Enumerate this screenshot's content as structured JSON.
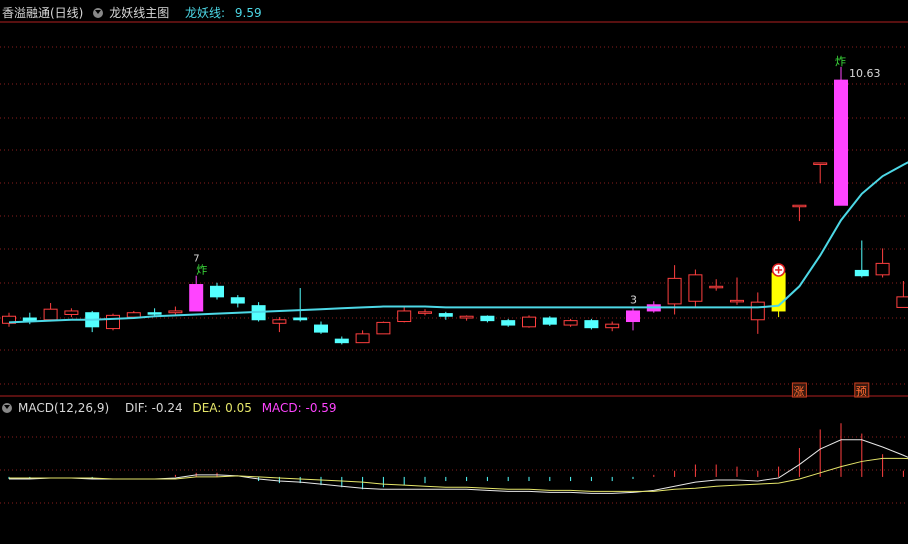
{
  "header_main": {
    "stock": "香溢融通(日线)",
    "indicator": "龙妖线主图",
    "line_label": "龙妖线:",
    "line_value": "9.59"
  },
  "header_macd": {
    "name": "MACD(12,26,9)",
    "dif": "DIF: -0.24",
    "dea": "DEA: 0.05",
    "macd": "MACD: -0.59"
  },
  "colors": {
    "up": "#ff4040",
    "down": "#54ffff",
    "signal_bar": "#ff44ff",
    "limit_up_bar": "#ffff00",
    "line": "#4dd8e6",
    "grid": "#8a1e1e"
  },
  "annotations": {
    "zha_1": "炸",
    "num_7": "7",
    "num_3": "3",
    "zha_2": "炸",
    "high_label": "10.63",
    "zhang": "涨",
    "yu": "预"
  },
  "chart_data": [
    {
      "type": "candlestick",
      "price_range": [
        7.0,
        11.2
      ],
      "high_mark": 10.63,
      "candles": [
        {
          "o": 7.78,
          "c": 7.86,
          "h": 7.9,
          "l": 7.74,
          "k": "up"
        },
        {
          "o": 7.84,
          "c": 7.8,
          "h": 7.9,
          "l": 7.77,
          "k": "down"
        },
        {
          "o": 7.82,
          "c": 7.94,
          "h": 8.01,
          "l": 7.8,
          "k": "up"
        },
        {
          "o": 7.88,
          "c": 7.92,
          "h": 7.95,
          "l": 7.85,
          "k": "up"
        },
        {
          "o": 7.9,
          "c": 7.74,
          "h": 7.92,
          "l": 7.68,
          "k": "down"
        },
        {
          "o": 7.72,
          "c": 7.87,
          "h": 7.89,
          "l": 7.7,
          "k": "up"
        },
        {
          "o": 7.85,
          "c": 7.9,
          "h": 7.92,
          "l": 7.83,
          "k": "up"
        },
        {
          "o": 7.9,
          "c": 7.89,
          "h": 7.95,
          "l": 7.85,
          "k": "down"
        },
        {
          "o": 7.9,
          "c": 7.92,
          "h": 7.97,
          "l": 7.88,
          "k": "up"
        },
        {
          "o": 7.92,
          "c": 8.22,
          "h": 8.32,
          "l": 7.92,
          "k": "signal"
        },
        {
          "o": 8.2,
          "c": 8.08,
          "h": 8.24,
          "l": 8.05,
          "k": "down"
        },
        {
          "o": 8.07,
          "c": 8.01,
          "h": 8.1,
          "l": 7.96,
          "k": "down"
        },
        {
          "o": 7.98,
          "c": 7.82,
          "h": 8.02,
          "l": 7.8,
          "k": "down"
        },
        {
          "o": 7.78,
          "c": 7.82,
          "h": 7.85,
          "l": 7.68,
          "k": "up"
        },
        {
          "o": 7.84,
          "c": 7.82,
          "h": 8.18,
          "l": 7.8,
          "k": "down"
        },
        {
          "o": 7.76,
          "c": 7.68,
          "h": 7.8,
          "l": 7.66,
          "k": "down"
        },
        {
          "o": 7.6,
          "c": 7.56,
          "h": 7.63,
          "l": 7.54,
          "k": "down"
        },
        {
          "o": 7.56,
          "c": 7.66,
          "h": 7.7,
          "l": 7.56,
          "k": "up"
        },
        {
          "o": 7.66,
          "c": 7.79,
          "h": 7.8,
          "l": 7.66,
          "k": "up"
        },
        {
          "o": 7.8,
          "c": 7.92,
          "h": 7.98,
          "l": 7.79,
          "k": "up"
        },
        {
          "o": 7.9,
          "c": 7.91,
          "h": 7.94,
          "l": 7.87,
          "k": "up"
        },
        {
          "o": 7.89,
          "c": 7.86,
          "h": 7.91,
          "l": 7.82,
          "k": "down"
        },
        {
          "o": 7.84,
          "c": 7.86,
          "h": 7.87,
          "l": 7.81,
          "k": "up"
        },
        {
          "o": 7.86,
          "c": 7.81,
          "h": 7.87,
          "l": 7.79,
          "k": "down"
        },
        {
          "o": 7.81,
          "c": 7.76,
          "h": 7.83,
          "l": 7.74,
          "k": "down"
        },
        {
          "o": 7.74,
          "c": 7.85,
          "h": 7.87,
          "l": 7.73,
          "k": "up"
        },
        {
          "o": 7.84,
          "c": 7.77,
          "h": 7.86,
          "l": 7.75,
          "k": "down"
        },
        {
          "o": 7.76,
          "c": 7.81,
          "h": 7.83,
          "l": 7.74,
          "k": "up"
        },
        {
          "o": 7.81,
          "c": 7.73,
          "h": 7.83,
          "l": 7.71,
          "k": "down"
        },
        {
          "o": 7.73,
          "c": 7.77,
          "h": 7.8,
          "l": 7.69,
          "k": "up"
        },
        {
          "o": 7.8,
          "c": 7.92,
          "h": 7.96,
          "l": 7.7,
          "k": "signal"
        },
        {
          "o": 7.92,
          "c": 7.99,
          "h": 8.03,
          "l": 7.9,
          "k": "signal"
        },
        {
          "o": 8.0,
          "c": 8.29,
          "h": 8.44,
          "l": 7.88,
          "k": "up"
        },
        {
          "o": 8.03,
          "c": 8.33,
          "h": 8.39,
          "l": 7.97,
          "k": "up"
        },
        {
          "o": 8.19,
          "c": 8.2,
          "h": 8.28,
          "l": 8.15,
          "k": "up"
        },
        {
          "o": 8.03,
          "c": 8.04,
          "h": 8.3,
          "l": 7.99,
          "k": "up"
        },
        {
          "o": 7.82,
          "c": 8.02,
          "h": 8.13,
          "l": 7.66,
          "k": "up"
        },
        {
          "o": 7.92,
          "c": 8.35,
          "h": 8.35,
          "l": 7.85,
          "k": "limit"
        },
        {
          "o": 9.11,
          "c": 9.12,
          "h": 9.12,
          "l": 8.94,
          "k": "up"
        },
        {
          "o": 9.59,
          "c": 9.6,
          "h": 9.6,
          "l": 9.37,
          "k": "up"
        },
        {
          "o": 9.12,
          "c": 10.54,
          "h": 10.69,
          "l": 9.12,
          "k": "signal"
        },
        {
          "o": 8.38,
          "c": 8.32,
          "h": 8.72,
          "l": 8.3,
          "k": "down"
        },
        {
          "o": 8.33,
          "c": 8.46,
          "h": 8.63,
          "l": 8.3,
          "k": "up"
        },
        {
          "o": 8.08,
          "c": 7.96,
          "h": 8.26,
          "l": 7.96,
          "k": "up"
        },
        {
          "o": 8.0,
          "c": 7.87,
          "h": 8.36,
          "l": 7.7,
          "k": "down"
        }
      ],
      "dragon_line": [
        7.79,
        7.8,
        7.81,
        7.82,
        7.82,
        7.83,
        7.84,
        7.86,
        7.87,
        7.88,
        7.89,
        7.9,
        7.91,
        7.92,
        7.93,
        7.94,
        7.95,
        7.96,
        7.97,
        7.97,
        7.97,
        7.96,
        7.96,
        7.96,
        7.96,
        7.96,
        7.96,
        7.96,
        7.96,
        7.96,
        7.96,
        7.96,
        7.96,
        7.96,
        7.96,
        7.96,
        7.96,
        7.98,
        8.2,
        8.55,
        8.95,
        9.25,
        9.45,
        9.58,
        9.7
      ]
    },
    {
      "type": "macd",
      "value_range": [
        -0.65,
        0.6
      ],
      "dif": [
        -0.02,
        -0.02,
        -0.01,
        -0.01,
        -0.02,
        -0.02,
        -0.02,
        -0.02,
        -0.01,
        0.02,
        0.02,
        0.01,
        -0.02,
        -0.04,
        -0.05,
        -0.07,
        -0.09,
        -0.11,
        -0.12,
        -0.12,
        -0.12,
        -0.12,
        -0.12,
        -0.13,
        -0.14,
        -0.14,
        -0.15,
        -0.15,
        -0.16,
        -0.16,
        -0.15,
        -0.13,
        -0.09,
        -0.05,
        -0.03,
        -0.03,
        -0.04,
        -0.01,
        0.12,
        0.27,
        0.36,
        0.36,
        0.29,
        0.21,
        0.12
      ],
      "dea": [
        -0.01,
        -0.01,
        -0.01,
        -0.01,
        -0.01,
        -0.02,
        -0.02,
        -0.02,
        -0.02,
        0.0,
        0.0,
        0.01,
        0.0,
        -0.01,
        -0.02,
        -0.03,
        -0.04,
        -0.05,
        -0.07,
        -0.08,
        -0.09,
        -0.1,
        -0.1,
        -0.11,
        -0.12,
        -0.12,
        -0.13,
        -0.13,
        -0.14,
        -0.14,
        -0.14,
        -0.14,
        -0.12,
        -0.11,
        -0.09,
        -0.08,
        -0.07,
        -0.06,
        -0.02,
        0.04,
        0.1,
        0.15,
        0.18,
        0.18,
        0.17
      ],
      "macd": [
        -0.02,
        -0.02,
        0.0,
        0.0,
        -0.02,
        0.0,
        0.0,
        0.0,
        0.02,
        0.04,
        0.04,
        0.0,
        -0.04,
        -0.06,
        -0.06,
        -0.08,
        -0.1,
        -0.12,
        -0.1,
        -0.08,
        -0.06,
        -0.04,
        -0.04,
        -0.04,
        -0.04,
        -0.04,
        -0.04,
        -0.04,
        -0.04,
        -0.04,
        -0.02,
        0.02,
        0.06,
        0.12,
        0.12,
        0.1,
        0.06,
        0.1,
        0.28,
        0.46,
        0.52,
        0.42,
        0.22,
        0.06,
        -0.1
      ]
    }
  ]
}
